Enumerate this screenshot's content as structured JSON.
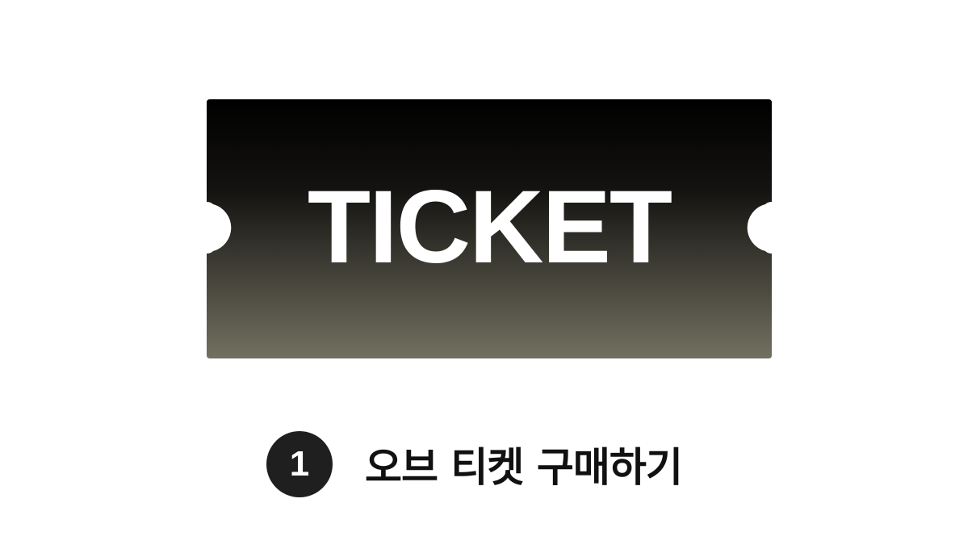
{
  "ticket": {
    "label": "TICKET",
    "gradient_top": "#000000",
    "gradient_bottom": "#727060",
    "text_color": "#ffffff"
  },
  "step": {
    "number": "1",
    "label": "오브 티켓 구매하기",
    "badge_color": "#1f1f1f"
  }
}
